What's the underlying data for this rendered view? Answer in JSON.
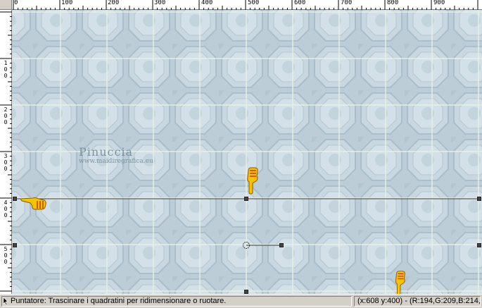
{
  "ruler": {
    "top_labels": [
      "0",
      "100",
      "200",
      "300",
      "400",
      "500",
      "600",
      "700",
      "800",
      "900"
    ],
    "left_labels": [
      "1\n0\n0",
      "2\n0\n0",
      "3\n0\n0",
      "4\n0\n0",
      "5\n0\n0"
    ]
  },
  "watermark": {
    "title": "Pinuccia",
    "url": "www.maidiregrafica.eu"
  },
  "status": {
    "message": "Puntatore: Trascinare i quadratini per ridimensionare o ruotare.",
    "coords": "(x:608 y:400) - (R:194,G:209,B:214,"
  },
  "colors": {
    "tile_base": "#bccdd8",
    "tile_light": "#d5e2e8",
    "tile_dark": "#a9bdc9",
    "grid": "#e8f0e4",
    "pointer": "#f5c400"
  },
  "icons": {
    "pointer_hand": "pointing-hand-icon",
    "status_cursor": "cursor-icon"
  }
}
